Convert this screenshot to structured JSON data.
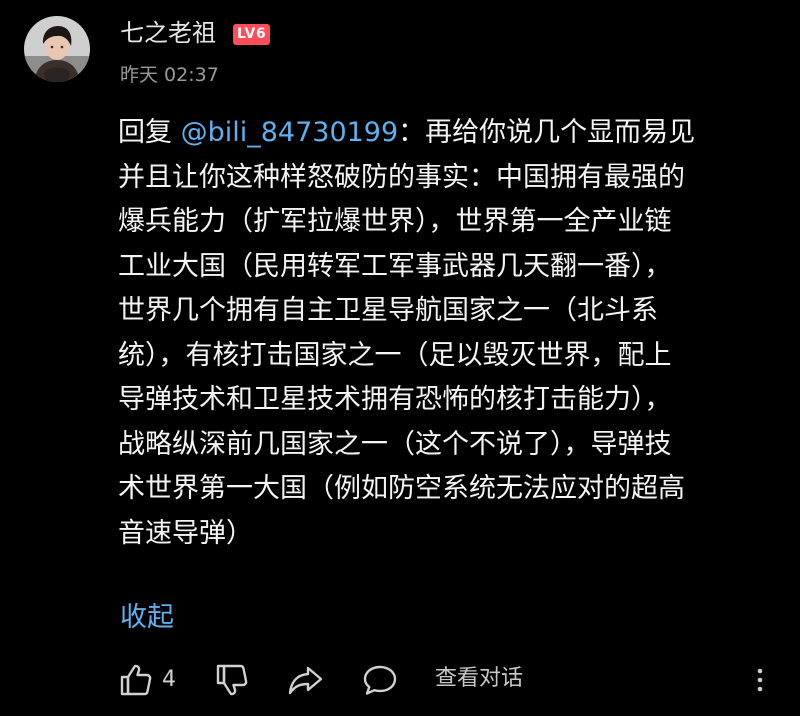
{
  "comment": {
    "author": {
      "name": "七之老祖",
      "level_badge": "LV6",
      "avatar_icon": "user-avatar"
    },
    "timestamp": "昨天 02:37",
    "reply_prefix": "回复",
    "mention": "@bili_84730199",
    "body_lines": [
      "：再给你说几个显而易见",
      "并且让你这种样怒破防的事实：中国拥有最强的",
      "爆兵能力（扩军拉爆世界），世界第一全产业链",
      "工业大国（民用转军工军事武器几天翻一番），",
      "世界几个拥有自主卫星导航国家之一（北斗系",
      "统），有核打击国家之一（足以毁灭世界，配上",
      "导弹技术和卫星技术拥有恐怖的核打击能力），",
      "战略纵深前几国家之一（这个不说了），导弹技",
      "术世界第一大国（例如防空系统无法应对的超高",
      "音速导弹）"
    ],
    "collapse_label": "收起"
  },
  "actions": {
    "like_icon": "thumbs-up-icon",
    "like_count": "4",
    "dislike_icon": "thumbs-down-icon",
    "share_icon": "share-icon",
    "reply_icon": "comment-icon",
    "view_conversation_label": "查看对话",
    "more_icon": "more-vertical-icon"
  },
  "colors": {
    "background": "#000000",
    "text": "#f4f4f4",
    "link": "#5fb0ec",
    "level_badge": "#ff4d5a",
    "muted": "#9a9a9a"
  }
}
